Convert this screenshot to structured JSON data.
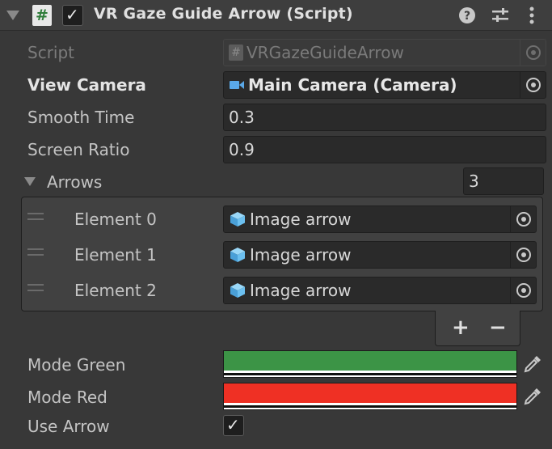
{
  "header": {
    "title": "VR Gaze Guide Arrow (Script)",
    "script_icon_glyph": "#",
    "check_glyph": "✓",
    "icons": [
      "help-icon",
      "preset-sliders-icon",
      "more-vert-icon"
    ]
  },
  "fields": {
    "script": {
      "label": "Script",
      "value": "VRGazeGuideArrow",
      "icon_glyph": "#"
    },
    "view_camera": {
      "label": "View Camera",
      "value": "Main Camera (Camera)"
    },
    "smooth_time": {
      "label": "Smooth Time",
      "value": "0.3"
    },
    "screen_ratio": {
      "label": "Screen Ratio",
      "value": "0.9"
    }
  },
  "arrows": {
    "label": "Arrows",
    "size": "3",
    "elements": [
      {
        "label": "Element 0",
        "value": "Image arrow"
      },
      {
        "label": "Element 1",
        "value": "Image arrow"
      },
      {
        "label": "Element 2",
        "value": "Image arrow"
      }
    ],
    "add_glyph": "+",
    "remove_glyph": "−"
  },
  "mode_green": {
    "label": "Mode Green",
    "color": "#3c9446"
  },
  "mode_red": {
    "label": "Mode Red",
    "color": "#ef3024"
  },
  "use_arrow": {
    "label": "Use Arrow",
    "checked": true,
    "check_glyph": "✓"
  },
  "colors": {
    "background": "#383838",
    "field": "#2a2a2a",
    "camera_icon": "#5aa8e8",
    "prefab_icon": "#6cc0f0"
  }
}
